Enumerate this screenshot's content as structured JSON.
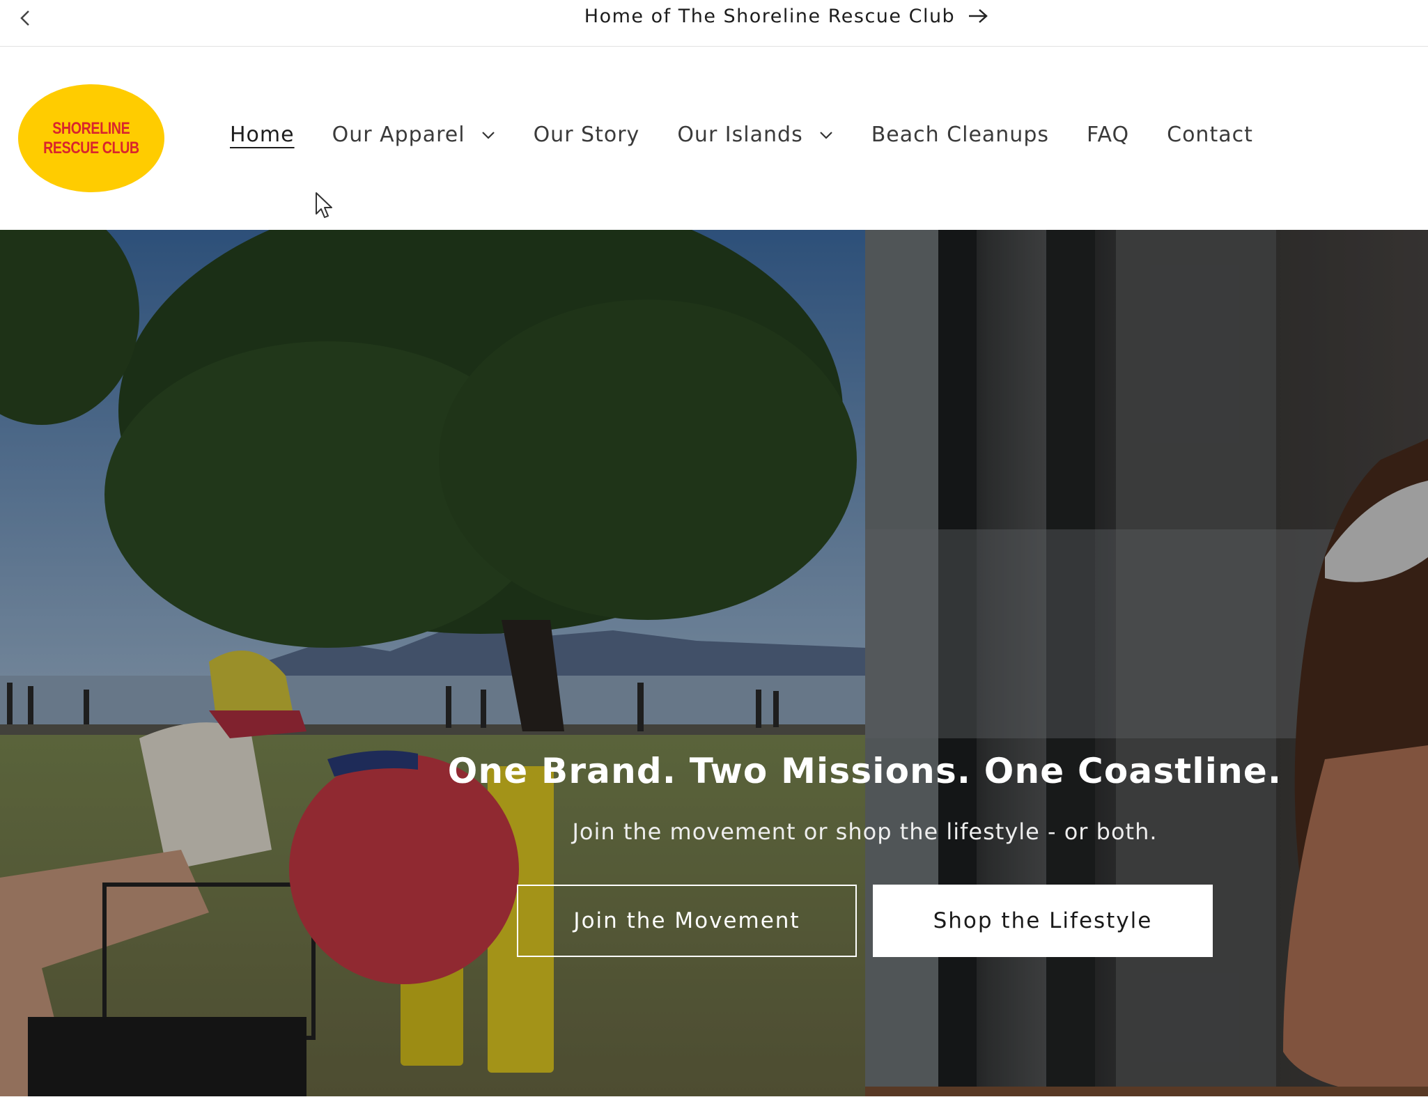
{
  "announcement": {
    "text": "Home of The Shoreline Rescue Club",
    "prev_icon": "chevron-left-icon",
    "arrow_icon": "arrow-right-icon"
  },
  "header": {
    "logo_line1": "SHORELINE",
    "logo_line2": "RESCUE CLUB",
    "logo_color": "#ffcc00",
    "logo_text_color": "#d9262c"
  },
  "nav": {
    "items": [
      {
        "label": "Home",
        "active": true,
        "has_dropdown": false
      },
      {
        "label": "Our Apparel",
        "active": false,
        "has_dropdown": true
      },
      {
        "label": "Our Story",
        "active": false,
        "has_dropdown": false
      },
      {
        "label": "Our Islands",
        "active": false,
        "has_dropdown": true
      },
      {
        "label": "Beach Cleanups",
        "active": false,
        "has_dropdown": false
      },
      {
        "label": "FAQ",
        "active": false,
        "has_dropdown": false
      },
      {
        "label": "Contact",
        "active": false,
        "has_dropdown": false
      }
    ]
  },
  "hero": {
    "title": "One Brand. Two Missions. One Coastline.",
    "subtitle": "Join the movement or shop the lifestyle - or both.",
    "primary_button": "Join the Movement",
    "secondary_button": "Shop the Lifestyle"
  }
}
